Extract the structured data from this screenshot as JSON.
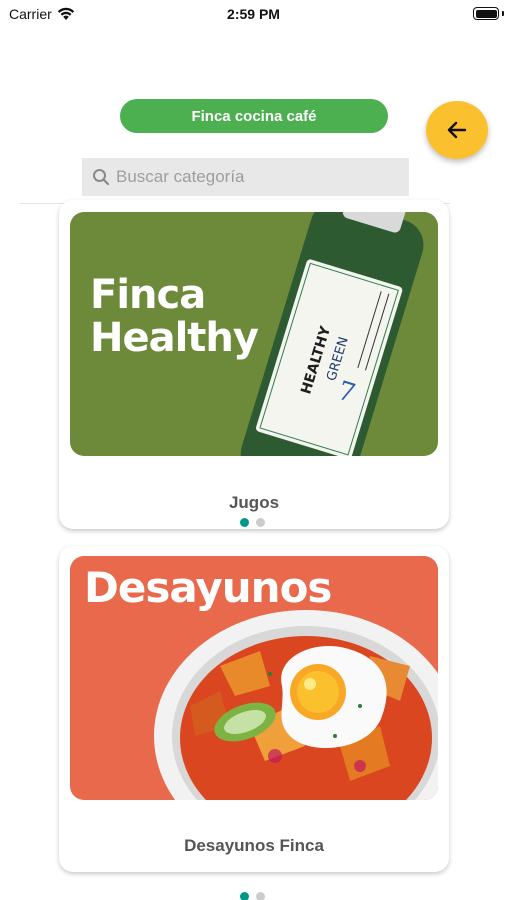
{
  "status_bar": {
    "carrier": "Carrier",
    "time": "2:59 PM"
  },
  "header": {
    "title": "Finca cocina café",
    "back_icon": "arrow-left-icon"
  },
  "search": {
    "placeholder": "Buscar categoría",
    "value": "",
    "icon": "search-icon"
  },
  "categories": [
    {
      "label": "Jugos",
      "banner_text_line1": "Finca",
      "banner_text_line2": "Healthy",
      "bottle_brand": "HEALTHY",
      "bottle_flavor": "GREEN",
      "bottle_number": "7",
      "banner_color": "#6c8a3a",
      "page_index": 0,
      "page_count": 2
    },
    {
      "label": "Desayunos Finca",
      "banner_text_line1": "Desayunos",
      "banner_color": "#e8694b",
      "page_index": 0,
      "page_count": 2
    }
  ],
  "colors": {
    "accent_green": "#4caf50",
    "back_button_yellow": "#fbc02d",
    "dot_active": "#009688",
    "dot_inactive": "#cccccc"
  }
}
